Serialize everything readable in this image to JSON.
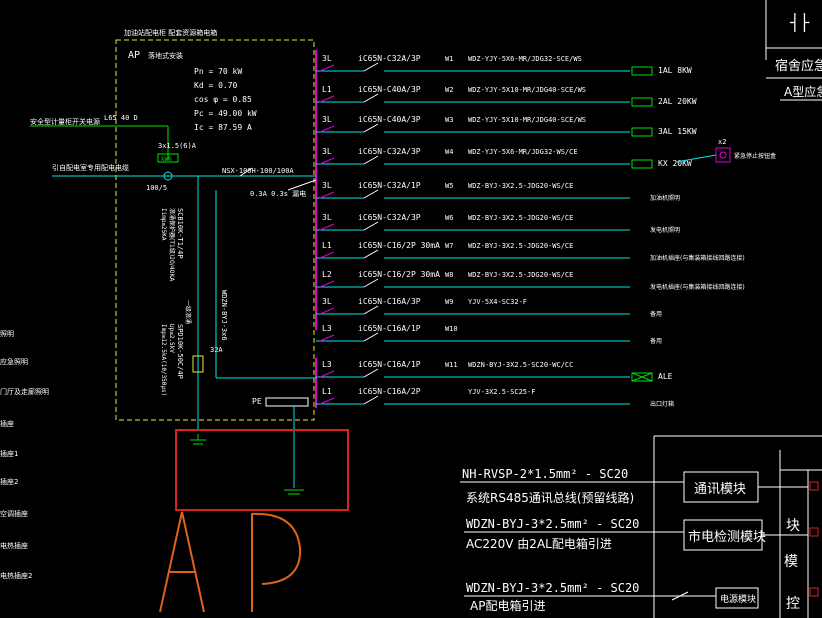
{
  "panel": {
    "title_top": "加油站配电柜 配套资源箱电箱",
    "label": "AP",
    "subtitle": "落地式安装",
    "params": [
      "Pn = 70 kW",
      "Kd = 0.70",
      "cos φ = 0.85",
      "Pc = 49.00 kW",
      "Ic = 87.59 A"
    ]
  },
  "incoming": {
    "lead_text": "安全型计量柜开关电源",
    "lead_breaker": "L65 40 D",
    "cable_label": "3x1.5(6)A",
    "meter": "kWh",
    "ct": "100/5",
    "main_feeder_label": "引自配电室专用配电电缆",
    "main_switch": "NSX-100H-100/100A",
    "rcd": "0.3A 0.3s 漏电",
    "vertical_cable": "WDZN-BYJ-3x6",
    "spd_left": "SCB10K-T1/4P",
    "spd_left_params": "浪涌保护器(T1级)20/40KA",
    "spd_left_params2": "Iimp≥25KA",
    "spd_right": "SPD10K-50C/4P",
    "spd_right_params": "Up≤2.5kV",
    "spd_right_params2": "Imp≥12.5kA(10/350μs)",
    "spd_label": "一级浪涌",
    "small_breaker": "32A",
    "pe_label": "PE"
  },
  "circuits": [
    {
      "phase": "3L",
      "breaker": "iC65N-C32A/3P",
      "no": "W1",
      "cable": "WDZ-YJY-5X6-MR/JDG32-SCE/WS",
      "load": "1AL 8KW"
    },
    {
      "phase": "L1",
      "breaker": "iC65N-C40A/3P",
      "no": "W2",
      "cable": "WDZ-YJY-5X10-MR/JDG40-SCE/WS",
      "load": "2AL 20KW"
    },
    {
      "phase": "3L",
      "breaker": "iC65N-C40A/3P",
      "no": "W3",
      "cable": "WDZ-YJY-5X10-MR/JDG40-SCE/WS",
      "load": "3AL 15KW"
    },
    {
      "phase": "3L",
      "breaker": "iC65N-C32A/3P",
      "no": "W4",
      "cable": "WDZ-YJY-5X6-MR/JDG32-WS/CE",
      "load": "KX 20KW"
    },
    {
      "phase": "3L",
      "breaker": "iC65N-C32A/1P",
      "no": "W5",
      "cable": "WDZ-BYJ-3X2.5-JDG20-WS/CE",
      "load": "加油机照明"
    },
    {
      "phase": "3L",
      "breaker": "iC65N-C32A/3P",
      "no": "W6",
      "cable": "WDZ-BYJ-3X2.5-JDG20-WS/CE",
      "load": "发电机照明"
    },
    {
      "phase": "L1",
      "breaker": "iC65N-C16/2P 30mA",
      "no": "W7",
      "cable": "WDZ-BYJ-3X2.5-JDG20-WS/CE",
      "load": "加油机插座(与集装箱接线回路连接)"
    },
    {
      "phase": "L2",
      "breaker": "iC65N-C16/2P 30mA",
      "no": "W8",
      "cable": "WDZ-BYJ-3X2.5-JDG20-WS/CE",
      "load": "发电机插座(与集装箱接线回路连接)"
    },
    {
      "phase": "3L",
      "breaker": "iC65N-C16A/3P",
      "no": "W9",
      "cable": "YJV-5X4-SC32-F",
      "load": "备用"
    },
    {
      "phase": "L3",
      "breaker": "iC65N-C16A/1P",
      "no": "W10",
      "cable": "",
      "load": "备用"
    },
    {
      "phase": "L3",
      "breaker": "iC65N-C16A/1P",
      "no": "W11",
      "cable": "WDZN-BYJ-3X2.5-SC20-WC/CC",
      "load": "ALE"
    },
    {
      "phase": "L1",
      "breaker": "iC65N-C16A/2P",
      "no": "",
      "cable": "YJV-3X2.5-SC25-F",
      "load": "出口灯箱"
    }
  ],
  "ext_device": {
    "tag": "x2",
    "label": "紧急停止按钮盒"
  },
  "right_top": {
    "sym": "┤├",
    "label": "宿舍应急",
    "label2": "A型应急"
  },
  "left_labels": [
    "照明",
    "应急照明",
    "门厅及走廊照明",
    "插座",
    "插座1",
    "插座2",
    "空调插座",
    "电热插座",
    "电热插座2"
  ],
  "lower_right": {
    "cable1": "NH-RVSP-2*1.5mm² - SC20",
    "note1": "系统RS485通讯总线(预留线路)",
    "module1": "通讯模块",
    "cable2": "WDZN-BYJ-3*2.5mm² - SC20",
    "note2": "AC220V 由2AL配电箱引进",
    "module2": "市电检测模块",
    "cable3": "WDZN-BYJ-3*2.5mm² - SC20",
    "note3": "AP配电箱引进",
    "module3": "电源模块",
    "vertical_labels": [
      "块",
      "模",
      "控"
    ]
  },
  "annotation": {
    "text": "AP",
    "color": "#e0621a",
    "box_color": "#e02020"
  },
  "colors": {
    "phase": "#e000e0",
    "cable": "#00e8e8",
    "text": "#ffffff",
    "panel_border": "#e8e840",
    "load_green": "#00e000",
    "device_magenta": "#e000e0",
    "neutral": "#ffffff"
  }
}
